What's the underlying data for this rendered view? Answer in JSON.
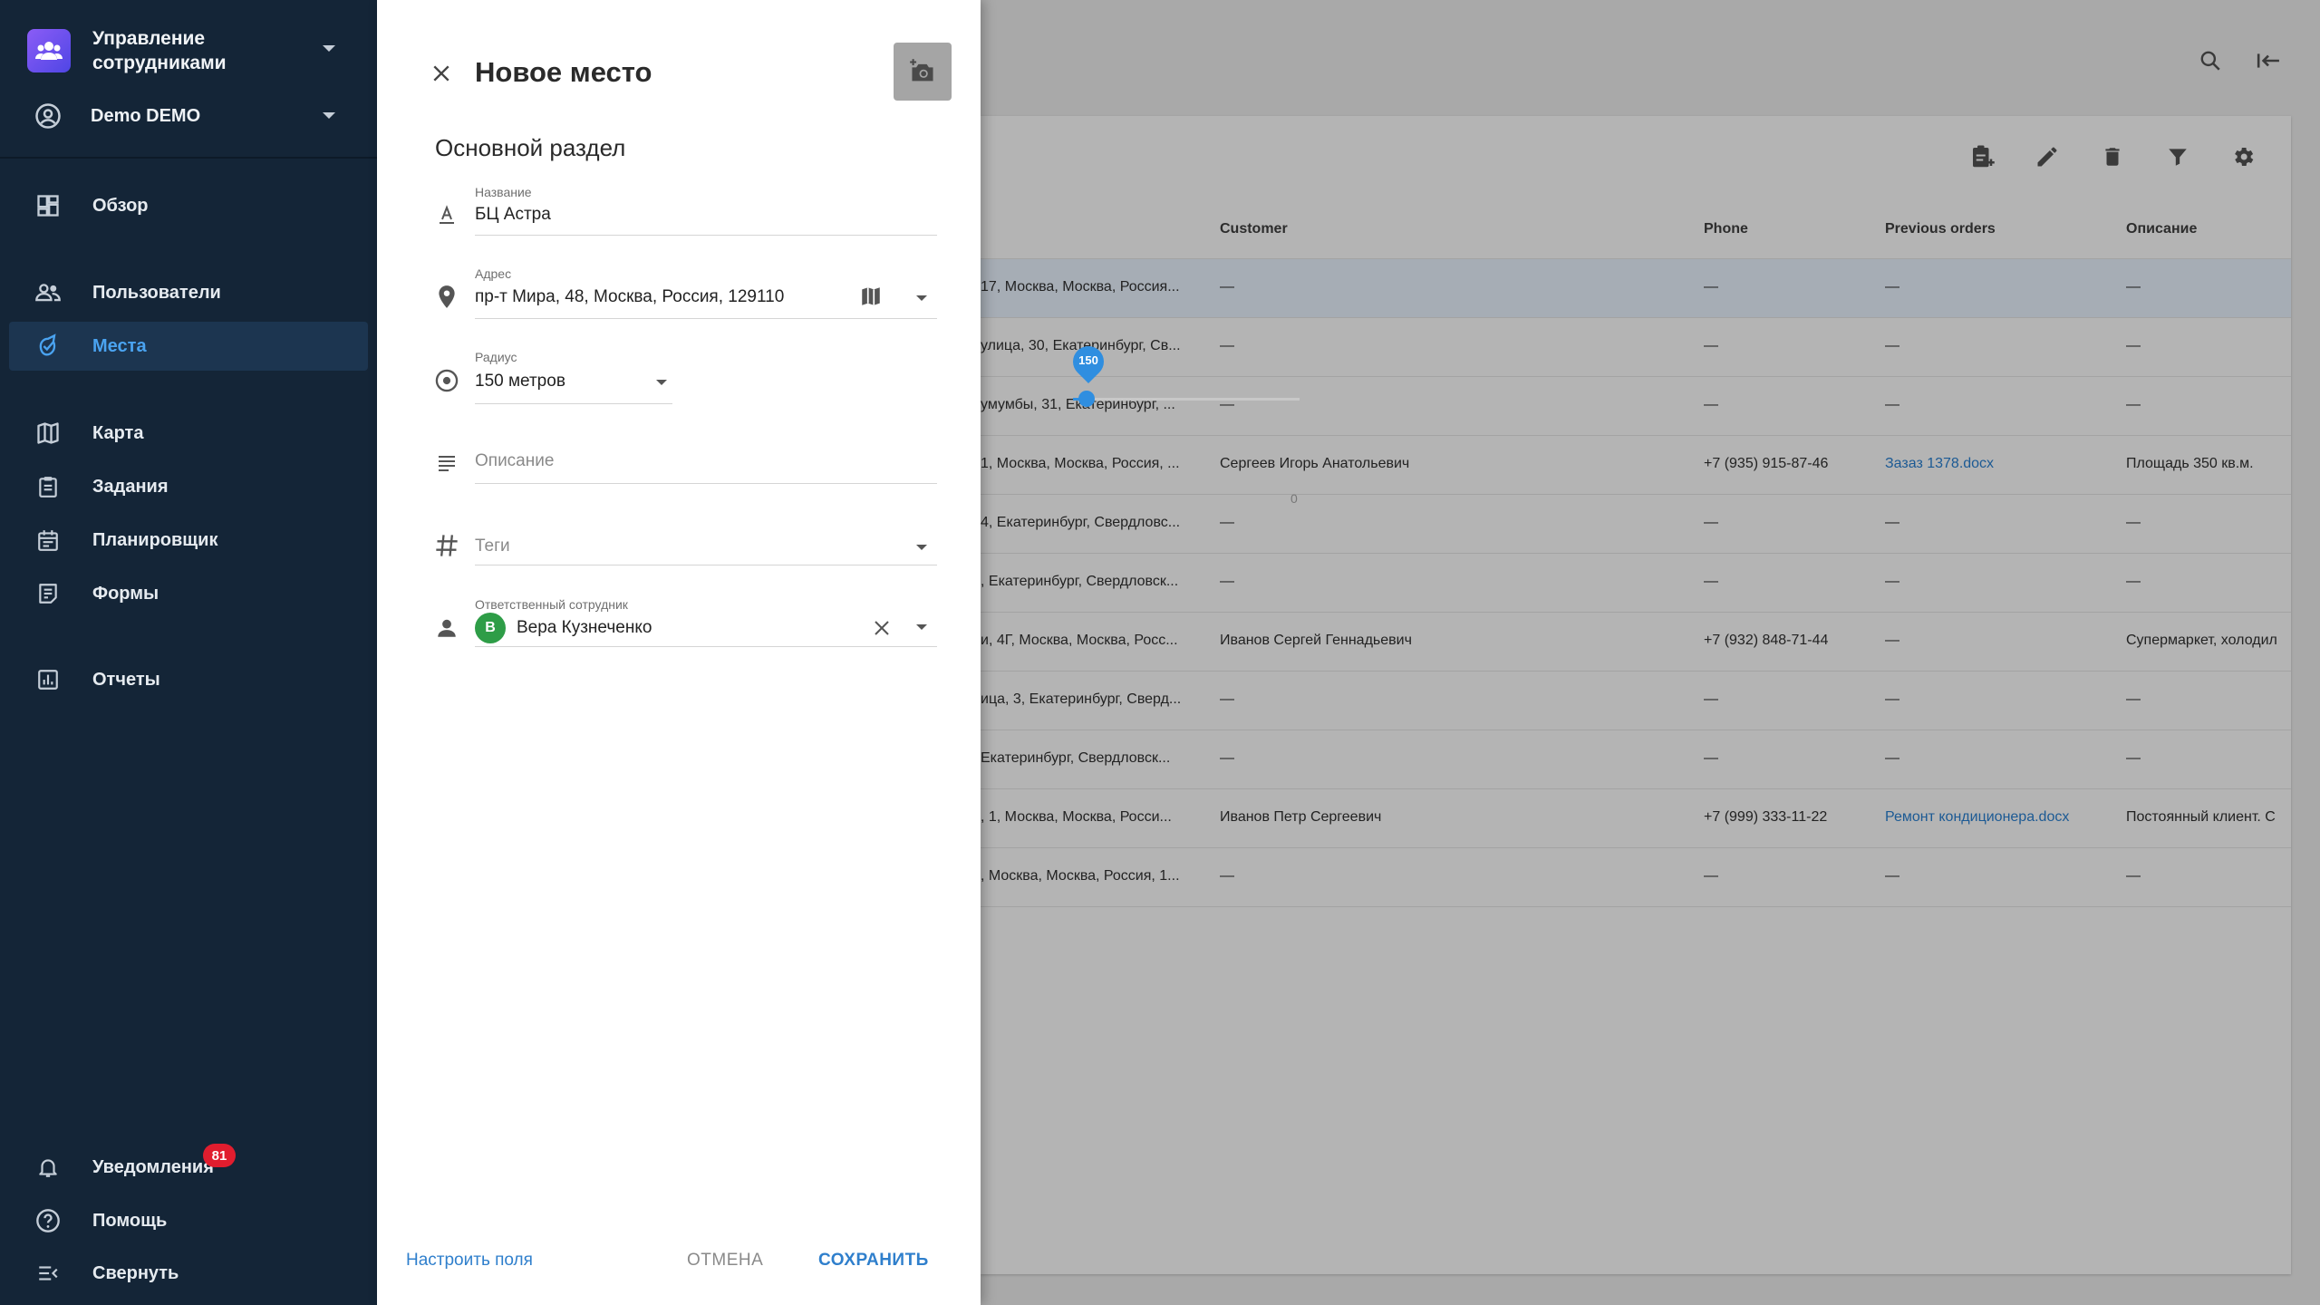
{
  "sidebar": {
    "org_name": "Управление сотрудниками",
    "user_name": "Demo DEMO",
    "nav": [
      {
        "label": "Обзор",
        "icon": "dashboard-icon"
      },
      {
        "label": "Пользователи",
        "icon": "users-icon"
      },
      {
        "label": "Места",
        "icon": "places-icon",
        "active": true
      },
      {
        "label": "Карта",
        "icon": "map-icon"
      },
      {
        "label": "Задания",
        "icon": "tasks-icon"
      },
      {
        "label": "Планировщик",
        "icon": "calendar-icon"
      },
      {
        "label": "Формы",
        "icon": "forms-icon"
      },
      {
        "label": "Отчеты",
        "icon": "reports-icon"
      }
    ],
    "notifications_label": "Уведомления",
    "notifications_count": "81",
    "help_label": "Помощь",
    "collapse_label": "Свернуть"
  },
  "table": {
    "columns": {
      "customer": "Customer",
      "phone": "Phone",
      "previous_orders": "Previous orders",
      "description": "Описание"
    },
    "rows": [
      {
        "address": "17, Москва, Москва, Россия...",
        "customer": "—",
        "phone": "—",
        "previous": "—",
        "description": "—"
      },
      {
        "address": "улица, 30, Екатеринбург, Св...",
        "customer": "—",
        "phone": "—",
        "previous": "—",
        "description": "—"
      },
      {
        "address": "умумбы, 31, Екатеринбург, ...",
        "customer": "—",
        "phone": "—",
        "previous": "—",
        "description": "—"
      },
      {
        "address": "1, Москва, Москва, Россия, ...",
        "customer": "Сергеев Игорь Анатольевич",
        "phone": "+7 (935) 915-87-46",
        "previous": "Зазаз 1378.docx",
        "description": "Площадь 350 кв.м."
      },
      {
        "address": "4, Екатеринбург, Свердловс...",
        "customer": "—",
        "phone": "—",
        "previous": "—",
        "description": "—"
      },
      {
        "address": ", Екатеринбург, Свердловск...",
        "customer": "—",
        "phone": "—",
        "previous": "—",
        "description": "—"
      },
      {
        "address": "и, 4Г, Москва, Москва, Росс...",
        "customer": "Иванов Сергей Геннадьевич",
        "phone": "+7 (932) 848-71-44",
        "previous": "—",
        "description": "Супермаркет, холодил"
      },
      {
        "address": "ица, 3, Екатеринбург, Сверд...",
        "customer": "—",
        "phone": "—",
        "previous": "—",
        "description": "—"
      },
      {
        "address": "Екатеринбург, Свердловск...",
        "customer": "—",
        "phone": "—",
        "previous": "—",
        "description": "—"
      },
      {
        "address": ", 1, Москва, Москва, Росси...",
        "customer": "Иванов Петр Сергеевич",
        "phone": "+7 (999) 333-11-22",
        "previous": "Ремонт кондиционера.docx",
        "description": "Постоянный клиент. С"
      },
      {
        "address": ", Москва, Москва, Россия, 1...",
        "customer": "—",
        "phone": "—",
        "previous": "—",
        "description": "—"
      }
    ]
  },
  "drawer": {
    "title": "Новое место",
    "section": "Основной раздел",
    "name": {
      "label": "Название",
      "value": "БЦ Астра"
    },
    "address": {
      "label": "Адрес",
      "value": "пр-т Мира, 48, Москва, Россия, 129110"
    },
    "radius": {
      "label": "Радиус",
      "value": "150 метров",
      "slider_value": "150",
      "slider_fraction": 0.05
    },
    "description": {
      "placeholder": "Описание",
      "counter": "0"
    },
    "tags": {
      "placeholder": "Теги"
    },
    "responsible": {
      "label": "Ответственный сотрудник",
      "avatar_letter": "В",
      "value": "Вера Кузнеченко"
    },
    "customize_fields": "Настроить поля",
    "cancel": "ОТМЕНА",
    "save": "СОХРАНИТЬ"
  },
  "colors": {
    "accent": "#2f8ee0",
    "sidebar_bg": "#142537",
    "badge": "#e11d2e"
  }
}
